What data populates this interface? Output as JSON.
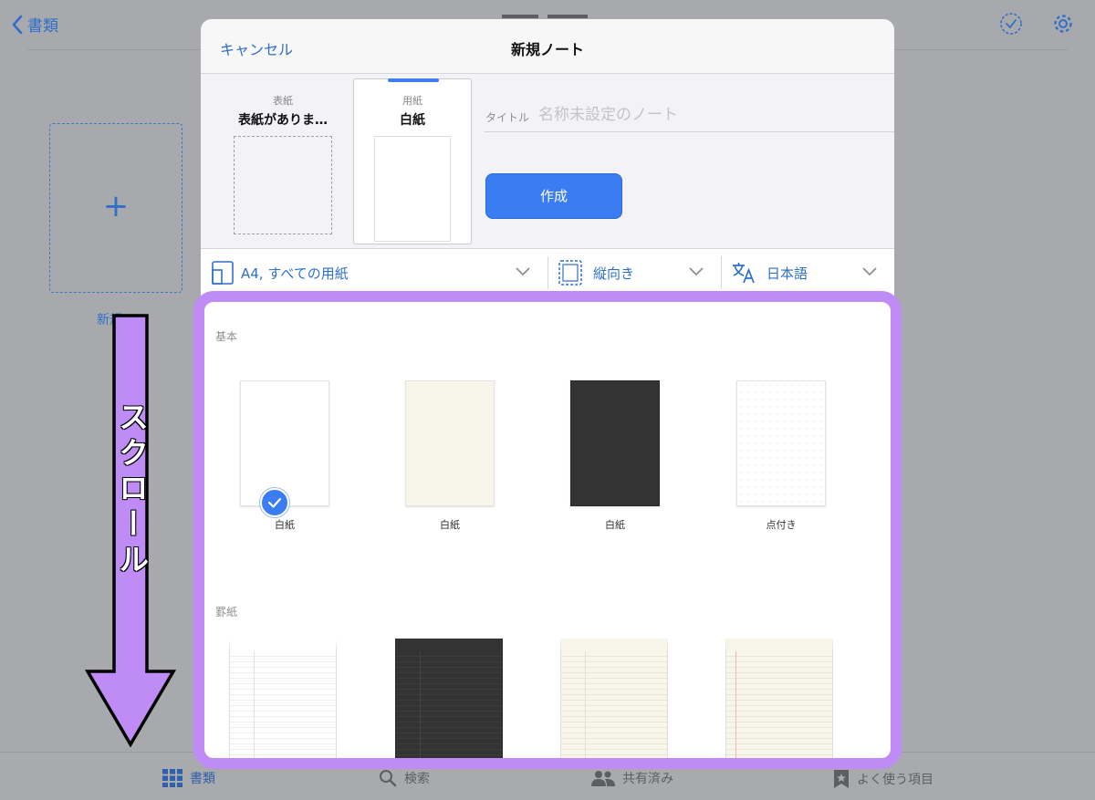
{
  "background": {
    "back_label": "書類",
    "new_tile_label": "新規",
    "tabs": [
      {
        "label": "書類",
        "icon": "grid-icon",
        "active": true
      },
      {
        "label": "検索",
        "icon": "search-icon",
        "active": false
      },
      {
        "label": "共有済み",
        "icon": "people-icon",
        "active": false
      },
      {
        "label": "よく使う項目",
        "icon": "star-bookmark-icon",
        "active": false
      }
    ]
  },
  "modal": {
    "cancel_label": "キャンセル",
    "title": "新規ノート",
    "cover": {
      "caption": "表紙",
      "name": "表紙がありま…"
    },
    "paper": {
      "caption": "用紙",
      "name": "白紙"
    },
    "title_field": {
      "label": "タイトル",
      "placeholder": "名称未設定のノート",
      "value": ""
    },
    "create_label": "作成",
    "options": {
      "size": "A4, すべての用紙",
      "orientation": "縦向き",
      "language": "日本語"
    }
  },
  "paper_picker": {
    "sections": [
      {
        "label": "基本",
        "items": [
          {
            "label": "白紙",
            "color": "#ffffff",
            "selected": true
          },
          {
            "label": "白紙",
            "color": "#f8f6ea",
            "selected": false
          },
          {
            "label": "白紙",
            "color": "#333333",
            "selected": false
          },
          {
            "label": "点付き",
            "color": "#ffffff",
            "selected": false
          }
        ]
      },
      {
        "label": "罫紙",
        "items": [
          {
            "color": "#ffffff"
          },
          {
            "color": "#333333"
          },
          {
            "color": "#f8f6ea"
          },
          {
            "color": "#f8f6ea"
          }
        ]
      }
    ]
  },
  "annotation": {
    "text": "スクロール",
    "color": "#bf8bf4"
  }
}
